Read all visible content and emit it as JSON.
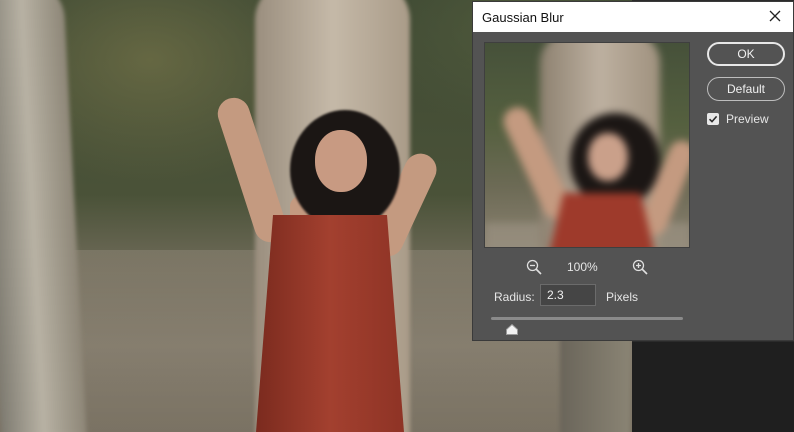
{
  "dialog": {
    "title": "Gaussian Blur",
    "close_icon": "close-icon",
    "ok_label": "OK",
    "default_label": "Default",
    "preview_label": "Preview",
    "preview_checked": true,
    "zoom_level": "100%",
    "zoom_out_icon": "zoom-out-icon",
    "zoom_in_icon": "zoom-in-icon",
    "radius_label": "Radius:",
    "radius_value": "2.3",
    "radius_units": "Pixels",
    "slider_fraction": 0.11
  },
  "colors": {
    "dialog_bg": "#535353",
    "titlebar_bg": "#ffffff",
    "right_panel_bg": "#1f1f1f"
  }
}
